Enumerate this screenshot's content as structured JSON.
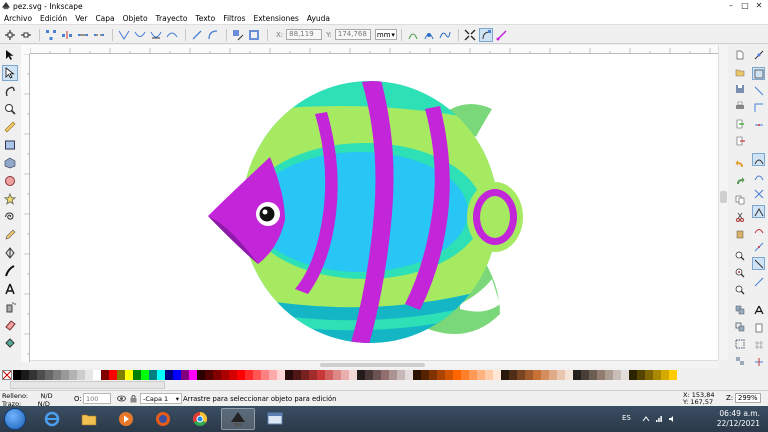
{
  "window": {
    "title": "pez.svg - Inkscape",
    "minimize": "–",
    "maximize": "□",
    "close": "✕"
  },
  "menu": [
    "Archivo",
    "Edición",
    "Ver",
    "Capa",
    "Objeto",
    "Trayecto",
    "Texto",
    "Filtros",
    "Extensiones",
    "Ayuda"
  ],
  "toolbar": {
    "x_label": "X:",
    "x_value": "88,119",
    "y_label": "Y:",
    "y_value": "174,768",
    "unit": "mm"
  },
  "palette": {
    "colors": [
      "#000000",
      "#1a1a1a",
      "#333333",
      "#4d4d4d",
      "#666666",
      "#808080",
      "#999999",
      "#b3b3b3",
      "#cccccc",
      "#e6e6e6",
      "#ffffff",
      "#800000",
      "#ff0000",
      "#808000",
      "#ffff00",
      "#008000",
      "#00ff00",
      "#008080",
      "#00ffff",
      "#000080",
      "#0000ff",
      "#800080",
      "#ff00ff",
      "#2b0000",
      "#550000",
      "#800000",
      "#aa0000",
      "#d40000",
      "#ff0000",
      "#ff2a2a",
      "#ff5555",
      "#ff8080",
      "#ffaaaa",
      "#ffd5d5",
      "#280b0b",
      "#501616",
      "#782121",
      "#a02c2c",
      "#c83737",
      "#d35f5f",
      "#de8787",
      "#e9afaf",
      "#f4d7d7",
      "#241c1c",
      "#483737",
      "#6c5353",
      "#916f6f",
      "#ac9393",
      "#c8b7b7",
      "#e3dbdb",
      "#2b1100",
      "#552200",
      "#803300",
      "#aa4400",
      "#d45500",
      "#ff6600",
      "#ff7f2a",
      "#ff9955",
      "#ffb380",
      "#ffccaa",
      "#ffe6d5",
      "#28170b",
      "#502d16",
      "#784421",
      "#a05a2c",
      "#c87137",
      "#d38d5f",
      "#deaa87",
      "#e9c6af",
      "#f4e3d7",
      "#241f1c",
      "#483e37",
      "#6c5d53",
      "#917c6f",
      "#ac9d93",
      "#c8beb7",
      "#e3dedb",
      "#2b2200",
      "#554400",
      "#806600",
      "#aa8800",
      "#d4aa00",
      "#ffcc00"
    ]
  },
  "status": {
    "fill_label": "Relleno:",
    "fill_value": "N/D",
    "stroke_label": "Trazo:",
    "stroke_value": "N/D",
    "opacity_label": "O:",
    "opacity_value": "100",
    "layer": "-Capa 1",
    "message": "Arrastre para seleccionar objeto para edición",
    "cursor_x_label": "X:",
    "cursor_x": "153,84",
    "cursor_y_label": "Y:",
    "cursor_y": "167,57",
    "zoom_label": "Z:",
    "zoom": "299%"
  },
  "taskbar": {
    "lang": "ES",
    "time": "06:49 a.m.",
    "date": "22/12/2021",
    "apps": [
      "explorer",
      "media-player",
      "firefox",
      "chrome",
      "inkscape",
      "window"
    ]
  },
  "colors": {
    "fish_body_teal": "#2de0b5",
    "fish_inner_blue": "#28c6f5",
    "fish_green": "#a6ea62",
    "fish_purple": "#c325d9",
    "fish_dark_purple": "#8d1aa8",
    "fish_tail": "#7ad87a",
    "fish_bottom": "#14b6c6"
  }
}
